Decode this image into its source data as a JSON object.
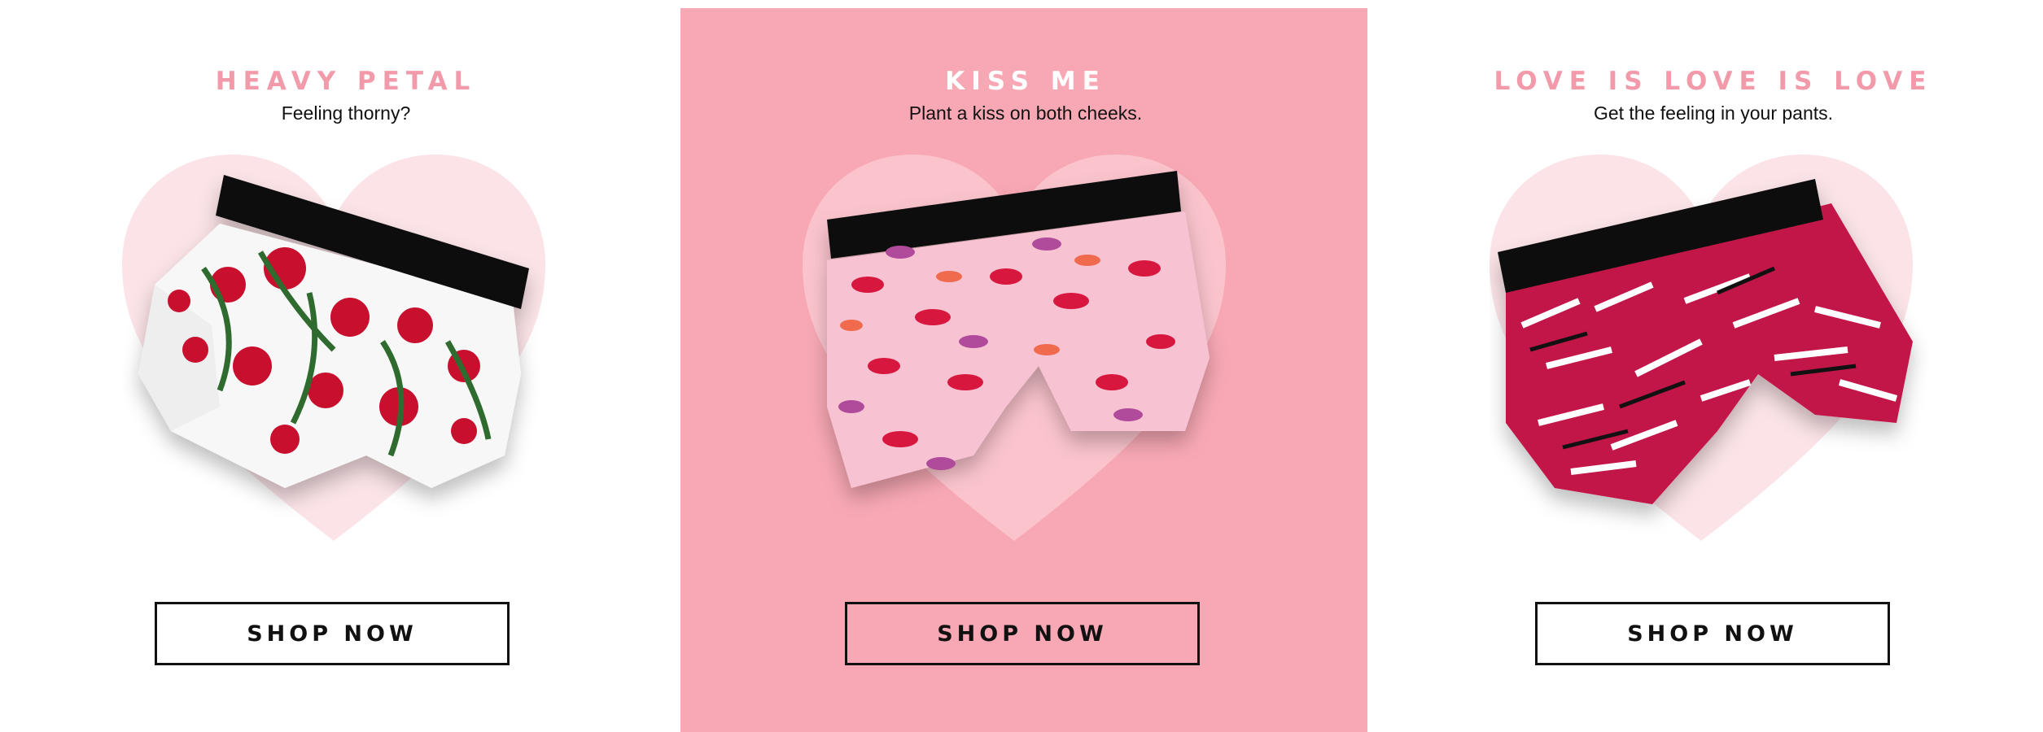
{
  "colors": {
    "accent_pink": "#f29aa9",
    "center_panel_bg": "#f8a8b4",
    "heart_light": "#fbe3e7",
    "text_dark": "#111111"
  },
  "panels": [
    {
      "title": "HEAVY PETAL",
      "subtitle": "Feeling thorny?",
      "button_label": "SHOP NOW",
      "product_image": "rose-print-boxer-briefs"
    },
    {
      "title": "KISS ME",
      "subtitle": "Plant a kiss on both cheeks.",
      "button_label": "SHOP NOW",
      "product_image": "lips-print-boxer-briefs"
    },
    {
      "title": "LOVE IS LOVE IS LOVE",
      "subtitle": "Get the feeling in your pants.",
      "button_label": "SHOP NOW",
      "product_image": "love-print-boxer-briefs"
    }
  ]
}
